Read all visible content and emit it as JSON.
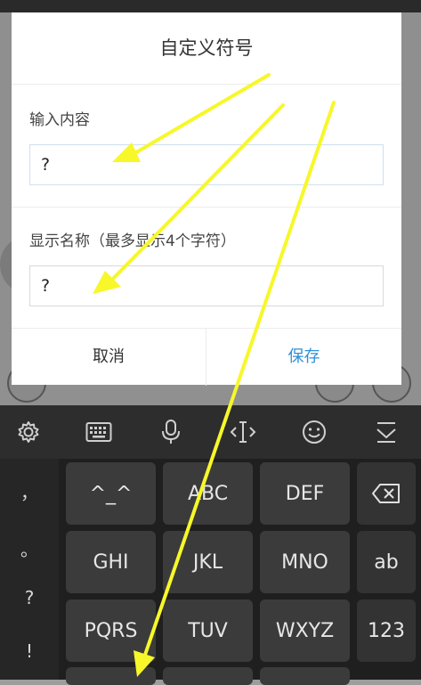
{
  "dialog": {
    "title": "自定义符号",
    "input_content_label": "输入内容",
    "input_content_value": "?",
    "display_name_label": "显示名称（最多显示4个字符）",
    "display_name_value": "?",
    "cancel_label": "取消",
    "save_label": "保存"
  },
  "keyboard": {
    "toolbar_icons": [
      "gear-icon",
      "keyboard-icon",
      "microphone-icon",
      "text-cursor-icon",
      "emoji-icon",
      "collapse-keyboard-icon"
    ],
    "symbol_column": [
      "，",
      "。",
      "?",
      "!"
    ],
    "keys": {
      "r1": [
        "^_^",
        "ABC",
        "DEF"
      ],
      "r2": [
        "GHI",
        "JKL",
        "MNO"
      ],
      "r3": [
        "PQRS",
        "TUV",
        "WXYZ"
      ],
      "side": [
        "backspace-icon",
        "ab",
        "123"
      ]
    }
  },
  "colors": {
    "accent": "#2c8fd8",
    "arrow": "#f7f72a"
  }
}
